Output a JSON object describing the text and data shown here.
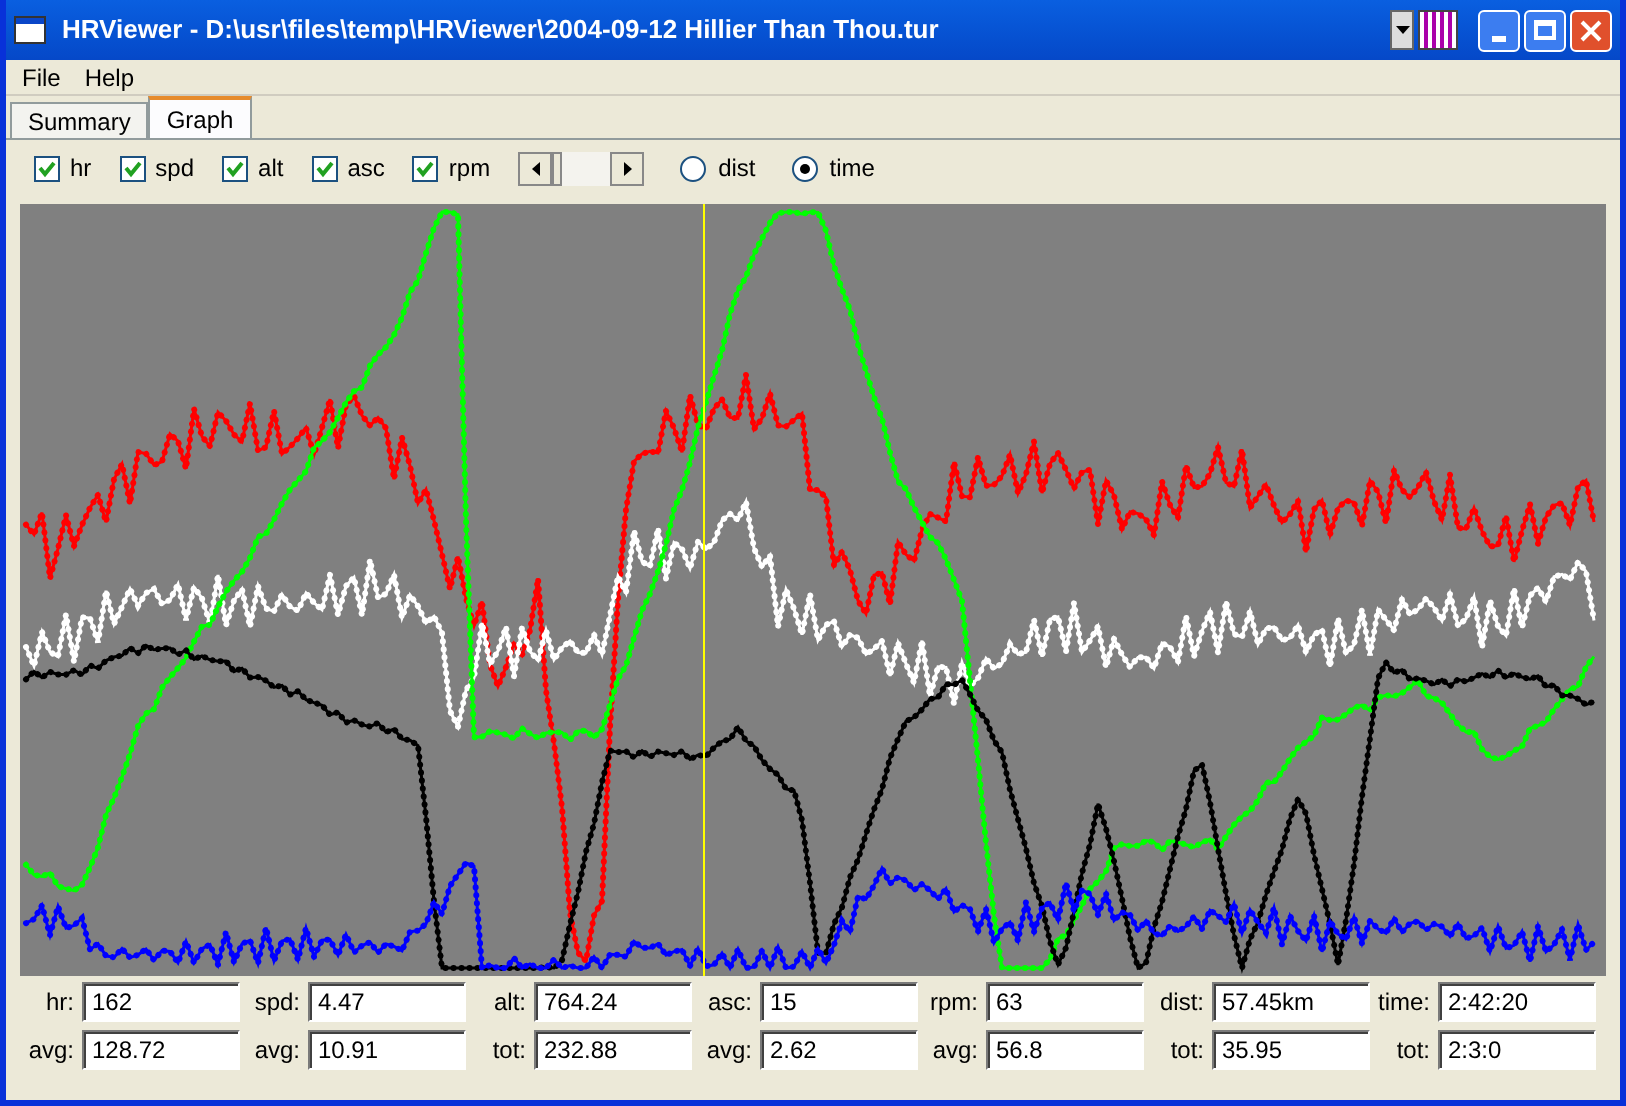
{
  "window": {
    "title": "HRViewer - D:\\usr\\files\\temp\\HRViewer\\2004-09-12 Hillier Than Thou.tur"
  },
  "menu": [
    "File",
    "Help"
  ],
  "tabs": [
    {
      "label": "Summary",
      "selected": false
    },
    {
      "label": "Graph",
      "selected": true
    }
  ],
  "toggles": [
    {
      "label": "hr",
      "checked": true
    },
    {
      "label": "spd",
      "checked": true
    },
    {
      "label": "alt",
      "checked": true
    },
    {
      "label": "asc",
      "checked": true
    },
    {
      "label": "rpm",
      "checked": true
    }
  ],
  "axis_mode": [
    {
      "label": "dist",
      "selected": false
    },
    {
      "label": "time",
      "selected": true
    }
  ],
  "stats": [
    [
      {
        "label": "hr:",
        "value": "162"
      },
      {
        "label": "spd:",
        "value": "4.47"
      },
      {
        "label": "alt:",
        "value": "764.24"
      },
      {
        "label": "asc:",
        "value": "15"
      },
      {
        "label": "rpm:",
        "value": "63"
      },
      {
        "label": "dist:",
        "value": "57.45km"
      },
      {
        "label": "time:",
        "value": "2:42:20"
      }
    ],
    [
      {
        "label": "avg:",
        "value": "128.72"
      },
      {
        "label": "avg:",
        "value": "10.91"
      },
      {
        "label": "tot:",
        "value": "232.88"
      },
      {
        "label": "avg:",
        "value": "2.62"
      },
      {
        "label": "avg:",
        "value": "56.8"
      },
      {
        "label": "tot:",
        "value": "35.95"
      },
      {
        "label": "tot:",
        "value": "2:3:0"
      }
    ]
  ]
}
